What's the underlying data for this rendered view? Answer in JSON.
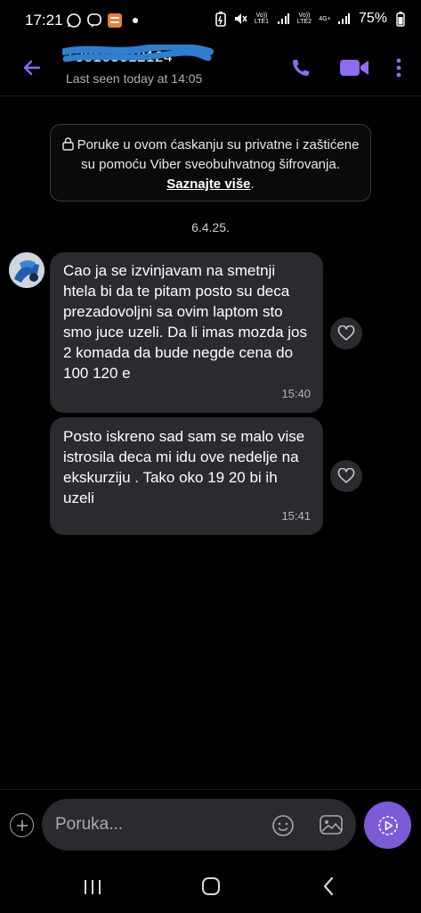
{
  "status_bar": {
    "time": "17:21",
    "battery": "75%",
    "sim1_label": "Vo)) LTE1",
    "sim2_label": "Vo)) LTE2",
    "network": "4G+"
  },
  "header": {
    "contact_name": "+38163312124",
    "last_seen": "Last seen today at 14:05"
  },
  "encryption_notice": {
    "text": "Poruke u ovom ćaskanju su privatne i zaštićene su pomoću Viber sveobuhvatnog šifrovanja.",
    "link": "Saznajte više"
  },
  "date_divider": "6.4.25.",
  "messages": [
    {
      "text": "Cao ja se izvinjavam na smetnji htela bi da te pitam posto su deca prezadovoljni sa ovim laptom sto smo juce uzeli. Da li imas mozda jos 2 komada da bude negde cena do 100 120 e",
      "time": "15:40"
    },
    {
      "text": "Posto iskreno sad sam se malo vise istrosila deca mi idu ove nedelje na ekskurziju . Tako oko 19 20 bi ih uzeli",
      "time": "15:41"
    }
  ],
  "composer": {
    "placeholder": "Poruka..."
  },
  "colors": {
    "accent": "#7c5bd6",
    "bubble": "#2b2b2f",
    "background": "#000000"
  },
  "icons": [
    "back-arrow-icon",
    "phone-icon",
    "video-camera-icon",
    "more-vert-icon",
    "lock-icon",
    "heart-icon",
    "plus-icon",
    "emoji-icon",
    "gallery-icon",
    "send-icon",
    "nav-recents-icon",
    "nav-home-icon",
    "nav-back-icon"
  ]
}
